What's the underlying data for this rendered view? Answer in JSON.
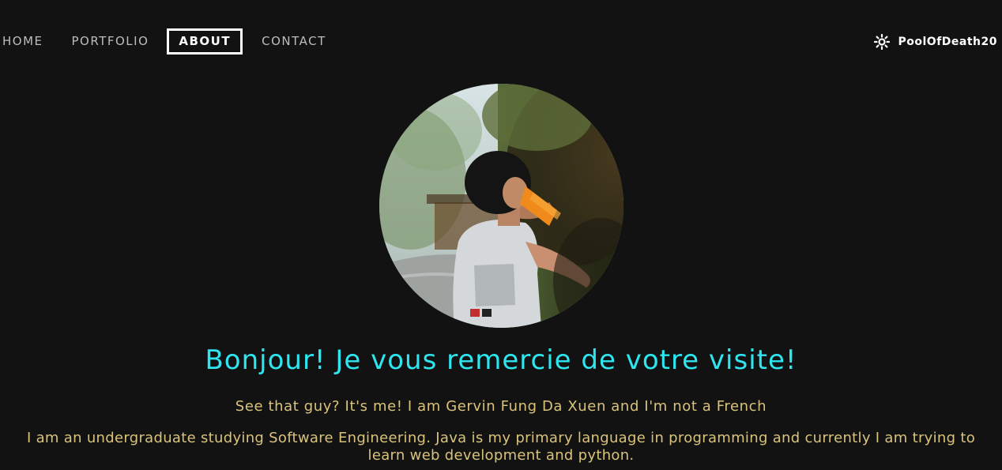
{
  "nav": {
    "items": [
      {
        "label": "HOME"
      },
      {
        "label": "PORTFOLIO"
      },
      {
        "label": "ABOUT",
        "active": true
      },
      {
        "label": "CONTACT"
      }
    ]
  },
  "user": {
    "theme_icon": "sun-icon",
    "username": "PoolOfDeath20"
  },
  "profile": {
    "photo": "profile-photo"
  },
  "about": {
    "heading": "Bonjour! Je vous remercie de votre visite!",
    "line1": "See that guy? It's me! I am Gervin Fung Da Xuen and I'm not a French",
    "line2": "I am an undergraduate studying Software Engineering. Java is my primary language in programming and currently I am trying to learn web development and python."
  },
  "colors": {
    "background": "#121212",
    "heading": "#2ee6f0",
    "body_text": "#d9c37b",
    "nav_text": "#bdbdbd",
    "active_nav": "#ffffff"
  }
}
